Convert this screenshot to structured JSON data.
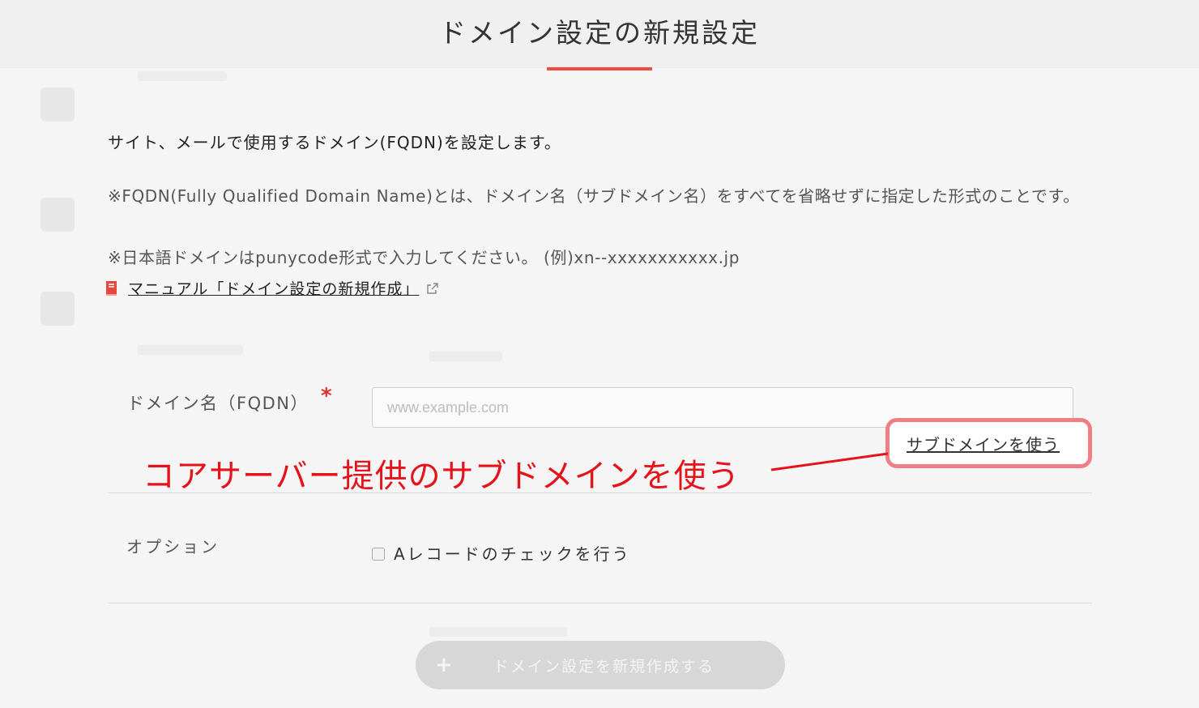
{
  "page": {
    "title": "ドメイン設定の新規設定",
    "intro": "サイト、メールで使用するドメイン(FQDN)を設定します。",
    "note_fqdn": "※FQDN(Fully Qualified Domain Name)とは、ドメイン名（サブドメイン名）をすべてを省略せずに指定した形式のことです。",
    "note_japanese": "※日本語ドメインはpunycode形式で入力してください。 (例)xn--xxxxxxxxxxx.jp",
    "manual_link": "マニュアル「ドメイン設定の新規作成」"
  },
  "form": {
    "domain_label": "ドメイン名（FQDN）",
    "required_mark": "*",
    "domain_placeholder": "www.example.com",
    "subdomain_link": "サブドメインを使う",
    "option_label": "オプション",
    "a_record_check_label": "Aレコードのチェックを行う",
    "a_record_checked": false,
    "create_button": "ドメイン設定を新規作成する",
    "create_button_icon": "+"
  },
  "annotation": {
    "text": "コアサーバー提供のサブドメインを使う",
    "color": "#e5141b"
  },
  "colors": {
    "accent": "#ef4b3f",
    "callout_border": "#ef7f86",
    "button_disabled": "#d7d7d7"
  },
  "icons": [
    "manual-book-icon",
    "external-link-icon",
    "plus-icon"
  ]
}
